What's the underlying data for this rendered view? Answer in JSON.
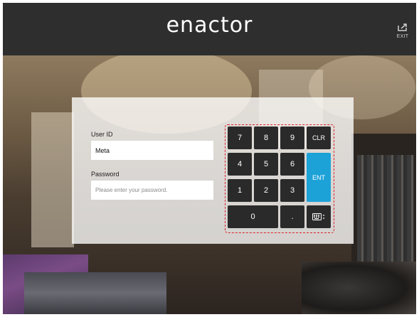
{
  "header": {
    "brand": "enactor",
    "exit_label": "EXIT"
  },
  "login": {
    "user_id_label": "User ID",
    "user_id_value": "Meta",
    "password_label": "Password",
    "password_placeholder": "Please enter your password."
  },
  "keypad": {
    "keys": [
      "7",
      "8",
      "9",
      "CLR",
      "4",
      "5",
      "6",
      "ENT",
      "1",
      "2",
      "3",
      "0",
      "."
    ],
    "highlight_color": "#d9232d",
    "enter_color": "#1da2d8"
  }
}
